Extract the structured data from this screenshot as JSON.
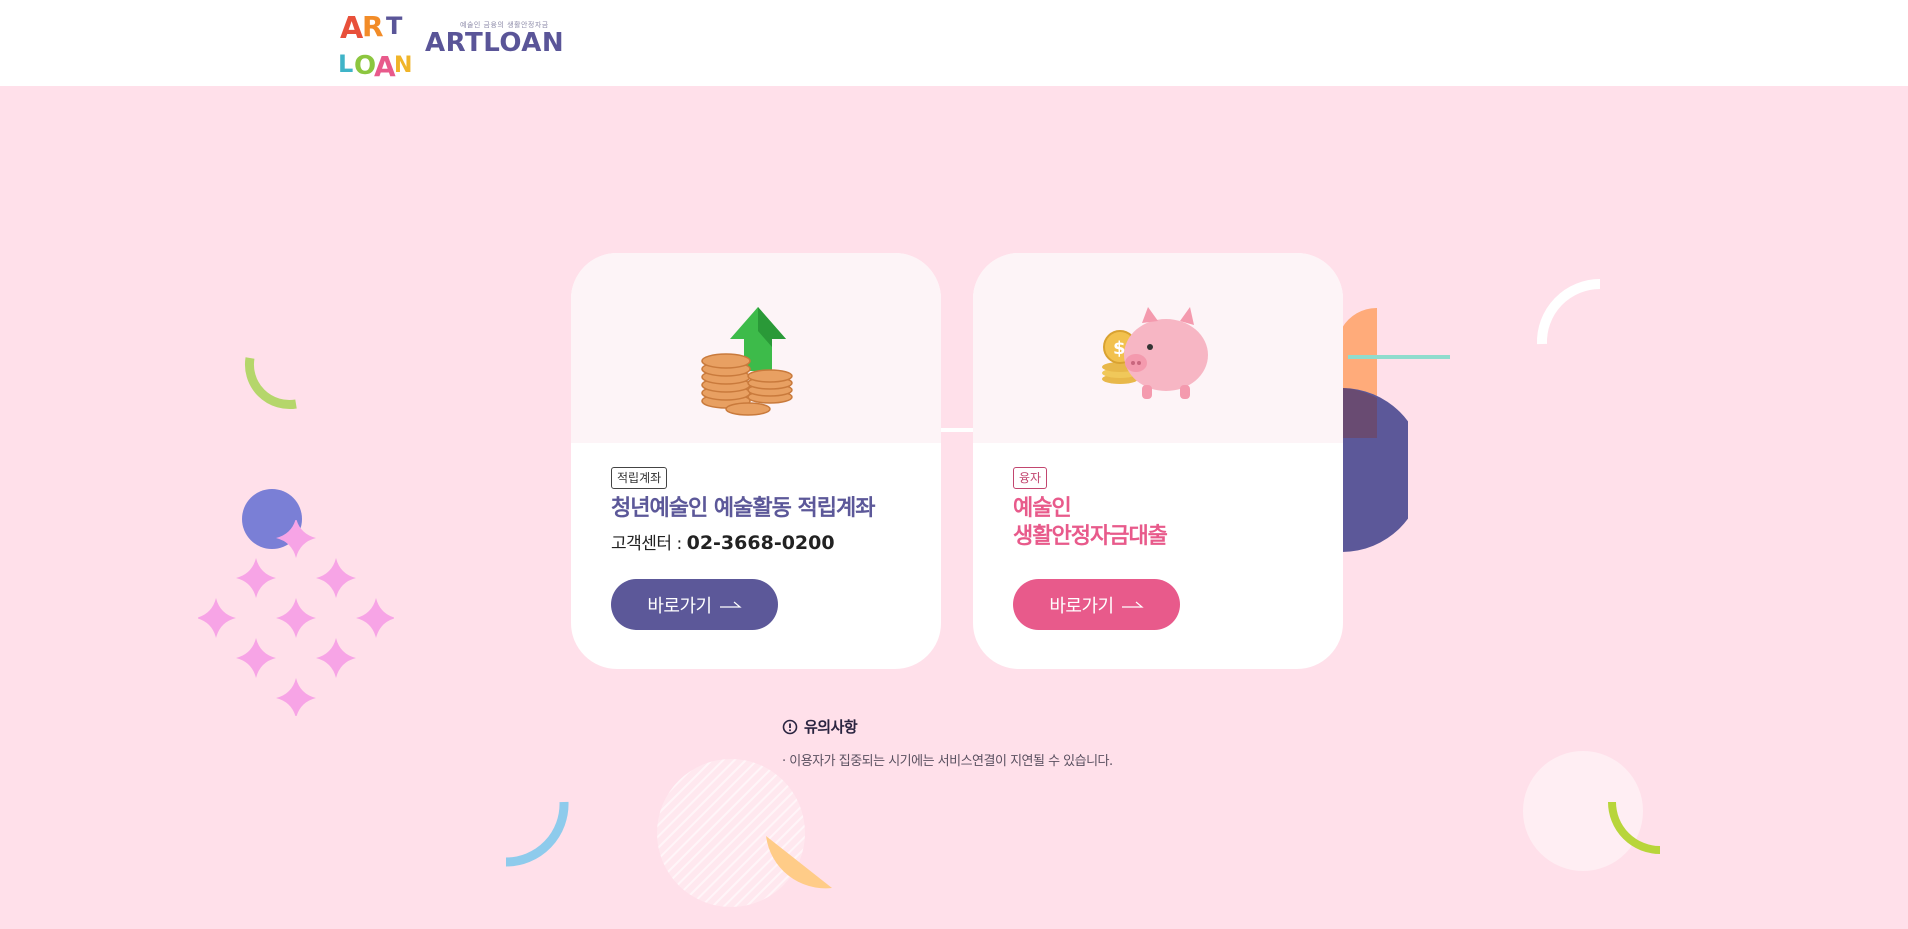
{
  "header": {
    "logo_mark_text": "ART LOAN",
    "logo_subtitle": "예술인 금융의 생활안정자금",
    "logo_text": "ARTLOAN"
  },
  "cards": [
    {
      "tag": "적립계좌",
      "title": "청년예술인 예술활동 적립계좌",
      "contact_label": "고객센터 : ",
      "contact_number": "02-3668-0200",
      "button_label": "바로가기",
      "accent": "#5c5899",
      "image_icon": "coins-arrow-up-icon"
    },
    {
      "tag": "융자",
      "title_line1": "예술인",
      "title_line2": "생활안정자금대출",
      "button_label": "바로가기",
      "accent": "#e85a8b",
      "image_icon": "piggy-bank-icon"
    }
  ],
  "notice": {
    "title": "유의사항",
    "items": [
      "· 이용자가 집중되는 시기에는 서비스연결이 지연될 수 있습니다."
    ],
    "icon": "info-circle-icon"
  },
  "colors": {
    "background": "#ffe0ea",
    "primary_navy": "#5c5899",
    "primary_pink": "#e85a8b"
  }
}
